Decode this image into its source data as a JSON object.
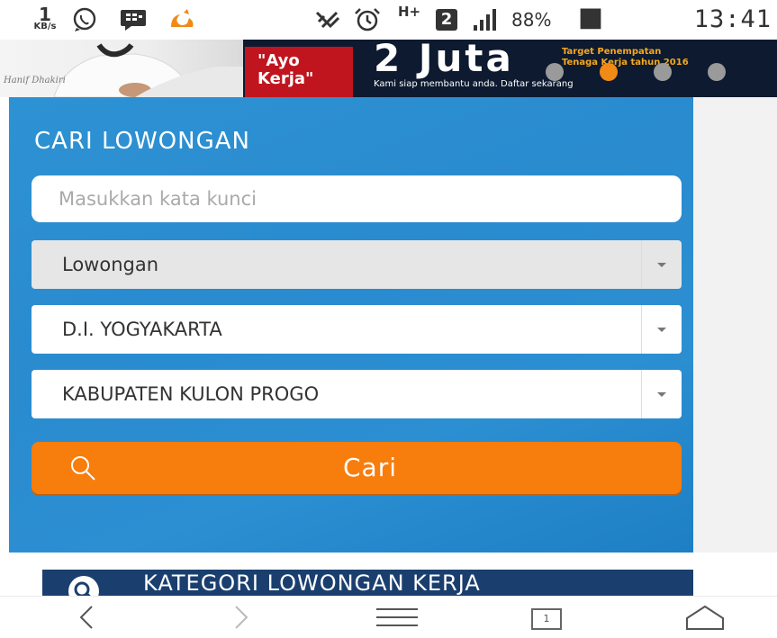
{
  "status_bar": {
    "speed_value": "1",
    "speed_unit": "KB/s",
    "network_h": "H+",
    "sim_number": "2",
    "battery": "88%",
    "time": "13:41"
  },
  "banner": {
    "person_name": "Hanif Dhakiri",
    "slogan_line1": "\"Ayo",
    "slogan_line2": "Kerja\"",
    "headline": "2 Juta",
    "subline": "Kami siap membantu anda. Daftar sekarang",
    "target_line1": "Target Penempatan",
    "target_line2": "Tenaga Kerja tahun 2016",
    "slide_count": 4,
    "active_slide": 2
  },
  "search": {
    "title": "CARI LOWONGAN",
    "keyword_placeholder": "Masukkan kata kunci",
    "type_value": "Lowongan",
    "province_value": "D.I. YOGYAKARTA",
    "regency_value": "KABUPATEN KULON PROGO",
    "submit_label": "Cari"
  },
  "categories": {
    "title": "KATEGORI LOWONGAN KERJA"
  },
  "nav": {
    "tab_count": "1"
  },
  "colors": {
    "panel_blue": "#2a8bcf",
    "button_orange": "#f77d0c",
    "category_navy": "#1a3f6f",
    "banner_red": "#c0151e",
    "banner_gold": "#f5a91d"
  }
}
